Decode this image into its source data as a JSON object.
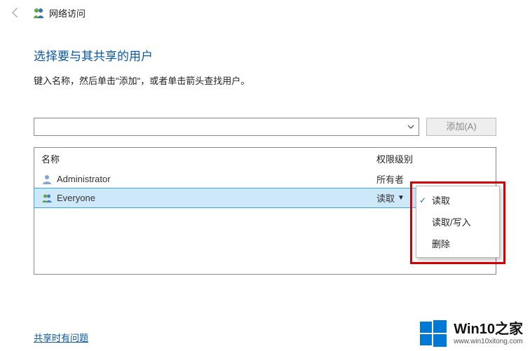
{
  "header": {
    "title": "网络访问"
  },
  "page": {
    "heading": "选择要与其共享的用户",
    "subtext": "键入名称，然后单击\"添加\"，或者单击箭头查找用户。"
  },
  "input": {
    "add_button": "添加(A)"
  },
  "table": {
    "col_name": "名称",
    "col_perm": "权限级别",
    "rows": [
      {
        "user": "Administrator",
        "perm": "所有者",
        "selected": false
      },
      {
        "user": "Everyone",
        "perm": "读取",
        "selected": true
      }
    ]
  },
  "menu": {
    "items": [
      {
        "label": "读取",
        "checked": true
      },
      {
        "label": "读取/写入",
        "checked": false
      },
      {
        "label": "删除",
        "checked": false
      }
    ]
  },
  "help_link": "共享时有问题",
  "watermark": {
    "line1": "Win10之家",
    "line2": "www.win10xitong.com"
  }
}
